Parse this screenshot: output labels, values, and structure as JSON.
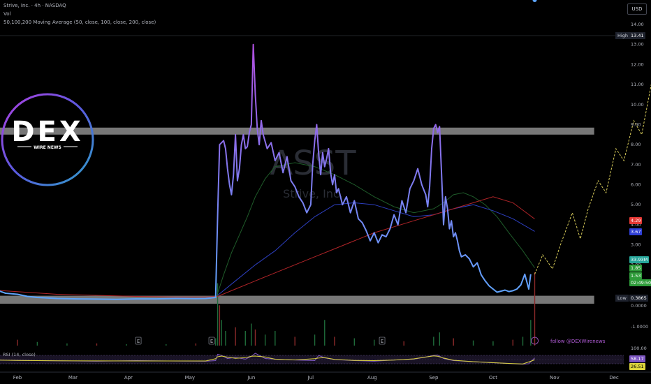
{
  "header": {
    "symbol_line": "Strive, Inc. · 4h · NASDAQ",
    "vol_label": "Vol",
    "ma_label": "50,100,200 Moving Average (50, close, 100, close, 200, close)"
  },
  "currency": "USD",
  "watermark": {
    "ticker": "ASST",
    "name": "Strive, Inc."
  },
  "logo": {
    "text": "DEX",
    "subtext": "WIRE NEWS"
  },
  "follow_text": "follow @DEXWirenews",
  "rsi_label": "RSI (14, close)",
  "price_labels": {
    "high_tag": "High",
    "high_value": "13.41",
    "low_tag": "Low",
    "low_value": "0.3865",
    "ma50": "4.29",
    "ma100": "3.67",
    "volume": "33.93M",
    "price_a": "1.85",
    "price_b": "1.53",
    "countdown": "02:49:50",
    "rsi_a": "58.17",
    "rsi_b": "26.51"
  },
  "colors": {
    "price_line_start": "#5ea6ff",
    "price_line_end": "#a050e0",
    "ma50": "#1f5c2a",
    "ma100": "#2d3fc0",
    "ma200": "#b02428",
    "zone": "#d8d8d8",
    "projection": "#d8cc5a",
    "label_high": "#1e222d",
    "label_red": "#e53935",
    "label_blue": "#2f3fd6",
    "label_teal": "#26a69a",
    "label_green": "#2e9c3a",
    "rsi_a": "#7e57c2",
    "rsi_b": "#dcd43c"
  },
  "chart_data": {
    "type": "line",
    "title": "Strive, Inc. · 4h · NASDAQ",
    "y_axis_ticks": [
      "14.00",
      "13.00",
      "12.00",
      "11.00",
      "10.00",
      "9.00",
      "8.00",
      "7.00",
      "6.00",
      "5.00",
      "4.00",
      "3.00",
      "2.00",
      "1.0000",
      "0.0000",
      "-1.0000"
    ],
    "rsi_axis_ticks": [
      "100.00"
    ],
    "ylim": [
      -1.6,
      14.4
    ],
    "x_tick_labels": [
      "Feb",
      "Mar",
      "Apr",
      "May",
      "Jun",
      "Jul",
      "Aug",
      "Sep",
      "Oct",
      "Nov",
      "Dec"
    ],
    "x_tick_day": [
      0,
      28,
      56,
      87,
      118,
      148,
      179,
      210,
      240,
      271,
      301
    ],
    "event_markers": [
      {
        "label": "E",
        "day": 61
      },
      {
        "label": "E",
        "day": 98
      },
      {
        "label": "E",
        "day": 184
      }
    ],
    "supply_zone": [
      8.5,
      8.85
    ],
    "demand_zone": [
      0.1,
      0.48
    ],
    "series": [
      {
        "name": "Price",
        "x_day": [
          -12,
          -6,
          0,
          5,
          10,
          20,
          30,
          40,
          50,
          60,
          70,
          80,
          90,
          95,
          100,
          101,
          102,
          104,
          105,
          106,
          107,
          108,
          109,
          110,
          111,
          112,
          113,
          114,
          115,
          116,
          117,
          118,
          119,
          120,
          121,
          122,
          123,
          124,
          126,
          128,
          130,
          132,
          134,
          136,
          138,
          140,
          142,
          144,
          146,
          148,
          149,
          150,
          151,
          152,
          153,
          154,
          155,
          156,
          157,
          158,
          159,
          160,
          161,
          162,
          164,
          166,
          168,
          170,
          172,
          174,
          176,
          178,
          180,
          182,
          184,
          186,
          188,
          190,
          192,
          194,
          196,
          198,
          200,
          202,
          204,
          206,
          207,
          208,
          209,
          210,
          211,
          212,
          213,
          214,
          215,
          216,
          217,
          218,
          219,
          220,
          221,
          222,
          223,
          224,
          226,
          228,
          230,
          232,
          234,
          236,
          238,
          240,
          242,
          244,
          246,
          248,
          250,
          252,
          254,
          256,
          258,
          259,
          260,
          261
        ],
        "y": [
          0.8,
          0.6,
          0.55,
          0.45,
          0.4,
          0.35,
          0.33,
          0.32,
          0.31,
          0.33,
          0.33,
          0.35,
          0.34,
          0.35,
          0.4,
          4.5,
          8.0,
          8.2,
          7.8,
          6.8,
          6.0,
          5.5,
          6.5,
          8.5,
          6.2,
          6.8,
          8.0,
          8.5,
          7.8,
          7.9,
          8.6,
          9.0,
          13.0,
          10.5,
          8.8,
          8.0,
          9.2,
          8.5,
          7.8,
          8.1,
          7.2,
          7.6,
          6.6,
          7.4,
          6.2,
          5.9,
          5.4,
          5.1,
          4.6,
          5.0,
          7.0,
          8.2,
          9.0,
          7.5,
          6.5,
          7.6,
          6.9,
          7.3,
          7.8,
          6.6,
          6.0,
          6.5,
          5.6,
          5.8,
          5.0,
          5.4,
          4.6,
          5.2,
          4.3,
          4.1,
          3.7,
          3.2,
          3.6,
          3.1,
          3.5,
          3.4,
          3.8,
          4.5,
          4.0,
          5.2,
          4.6,
          5.8,
          6.2,
          6.8,
          6.0,
          5.5,
          4.9,
          5.9,
          7.8,
          8.8,
          9.0,
          8.6,
          8.9,
          6.5,
          4.0,
          5.4,
          4.8,
          3.8,
          4.2,
          3.4,
          3.6,
          3.2,
          2.7,
          2.4,
          2.5,
          2.3,
          1.9,
          2.1,
          1.5,
          1.2,
          0.95,
          0.8,
          0.65,
          0.7,
          0.75,
          0.68,
          0.72,
          0.8,
          1.0,
          1.53,
          0.8,
          1.53
        ]
      },
      {
        "name": "MA50",
        "x_day": [
          101,
          104,
          108,
          112,
          116,
          120,
          125,
          130,
          140,
          150,
          160,
          170,
          180,
          190,
          200,
          210,
          215,
          220,
          225,
          230,
          236,
          242,
          248,
          255,
          261
        ],
        "y": [
          0.6,
          1.5,
          2.6,
          3.5,
          4.4,
          5.4,
          6.3,
          6.9,
          7.1,
          6.9,
          6.5,
          6.0,
          5.4,
          4.9,
          4.6,
          4.8,
          5.1,
          5.5,
          5.6,
          5.4,
          5.0,
          4.4,
          3.6,
          2.7,
          1.85
        ]
      },
      {
        "name": "MA100",
        "x_day": [
          101,
          110,
          120,
          130,
          140,
          150,
          160,
          170,
          180,
          190,
          200,
          210,
          220,
          230,
          240,
          250,
          261
        ],
        "y": [
          0.5,
          1.2,
          2.0,
          2.7,
          3.6,
          4.4,
          5.0,
          5.1,
          5.0,
          4.7,
          4.4,
          4.5,
          4.8,
          5.0,
          4.7,
          4.3,
          3.67
        ]
      },
      {
        "name": "MA200",
        "x_day": [
          -12,
          20,
          60,
          80,
          95,
          101,
          110,
          120,
          130,
          140,
          150,
          160,
          170,
          180,
          190,
          200,
          210,
          220,
          230,
          240,
          250,
          261
        ],
        "y": [
          0.75,
          0.55,
          0.45,
          0.42,
          0.42,
          0.45,
          0.8,
          1.2,
          1.6,
          2.0,
          2.4,
          2.8,
          3.2,
          3.6,
          3.9,
          4.2,
          4.5,
          4.8,
          5.1,
          5.4,
          5.1,
          4.29
        ]
      },
      {
        "name": "Projection",
        "x_day": [
          261,
          265,
          270,
          274,
          280,
          284,
          288,
          293,
          297,
          302,
          306,
          311,
          315,
          320
        ],
        "y": [
          1.53,
          2.5,
          1.8,
          3.0,
          4.6,
          3.3,
          4.8,
          6.2,
          5.6,
          7.8,
          7.2,
          9.2,
          8.5,
          11.1
        ]
      }
    ],
    "volume": {
      "x_day": [
        -12,
        0,
        10,
        25,
        40,
        55,
        75,
        90,
        100,
        101,
        102,
        103,
        105,
        110,
        115,
        118,
        120,
        125,
        130,
        140,
        150,
        155,
        160,
        170,
        180,
        195,
        210,
        213,
        220,
        230,
        240,
        250,
        255,
        259,
        261
      ],
      "values_relative": [
        0.15,
        0.08,
        0.05,
        0.03,
        0.03,
        0.02,
        0.02,
        0.03,
        0.1,
        0.85,
        0.55,
        0.35,
        0.2,
        0.25,
        0.2,
        0.3,
        0.22,
        0.15,
        0.2,
        0.12,
        0.15,
        0.35,
        0.12,
        0.1,
        0.08,
        0.06,
        0.12,
        0.18,
        0.1,
        0.07,
        0.06,
        0.08,
        0.12,
        0.35,
        1.0
      ]
    },
    "rsi": {
      "x_day": [
        -12,
        0,
        20,
        40,
        60,
        80,
        95,
        100,
        101,
        103,
        106,
        110,
        115,
        118,
        120,
        125,
        130,
        140,
        150,
        152,
        155,
        160,
        170,
        180,
        190,
        200,
        205,
        210,
        212,
        215,
        220,
        230,
        240,
        250,
        255,
        258,
        261
      ],
      "values": [
        48,
        46,
        44,
        42,
        45,
        43,
        42,
        45,
        75,
        70,
        55,
        60,
        52,
        65,
        80,
        55,
        52,
        48,
        45,
        70,
        58,
        50,
        45,
        42,
        48,
        52,
        60,
        70,
        72,
        55,
        45,
        40,
        35,
        30,
        28,
        30,
        58
      ]
    }
  }
}
